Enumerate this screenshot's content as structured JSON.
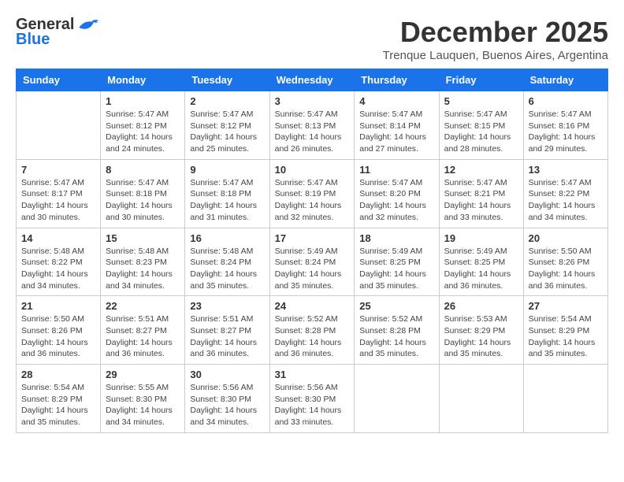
{
  "logo": {
    "general": "General",
    "blue": "Blue"
  },
  "title": "December 2025",
  "subtitle": "Trenque Lauquen, Buenos Aires, Argentina",
  "days_of_week": [
    "Sunday",
    "Monday",
    "Tuesday",
    "Wednesday",
    "Thursday",
    "Friday",
    "Saturday"
  ],
  "weeks": [
    [
      {
        "day": "",
        "info": ""
      },
      {
        "day": "1",
        "info": "Sunrise: 5:47 AM\nSunset: 8:12 PM\nDaylight: 14 hours\nand 24 minutes."
      },
      {
        "day": "2",
        "info": "Sunrise: 5:47 AM\nSunset: 8:12 PM\nDaylight: 14 hours\nand 25 minutes."
      },
      {
        "day": "3",
        "info": "Sunrise: 5:47 AM\nSunset: 8:13 PM\nDaylight: 14 hours\nand 26 minutes."
      },
      {
        "day": "4",
        "info": "Sunrise: 5:47 AM\nSunset: 8:14 PM\nDaylight: 14 hours\nand 27 minutes."
      },
      {
        "day": "5",
        "info": "Sunrise: 5:47 AM\nSunset: 8:15 PM\nDaylight: 14 hours\nand 28 minutes."
      },
      {
        "day": "6",
        "info": "Sunrise: 5:47 AM\nSunset: 8:16 PM\nDaylight: 14 hours\nand 29 minutes."
      }
    ],
    [
      {
        "day": "7",
        "info": "Sunrise: 5:47 AM\nSunset: 8:17 PM\nDaylight: 14 hours\nand 30 minutes."
      },
      {
        "day": "8",
        "info": "Sunrise: 5:47 AM\nSunset: 8:18 PM\nDaylight: 14 hours\nand 30 minutes."
      },
      {
        "day": "9",
        "info": "Sunrise: 5:47 AM\nSunset: 8:18 PM\nDaylight: 14 hours\nand 31 minutes."
      },
      {
        "day": "10",
        "info": "Sunrise: 5:47 AM\nSunset: 8:19 PM\nDaylight: 14 hours\nand 32 minutes."
      },
      {
        "day": "11",
        "info": "Sunrise: 5:47 AM\nSunset: 8:20 PM\nDaylight: 14 hours\nand 32 minutes."
      },
      {
        "day": "12",
        "info": "Sunrise: 5:47 AM\nSunset: 8:21 PM\nDaylight: 14 hours\nand 33 minutes."
      },
      {
        "day": "13",
        "info": "Sunrise: 5:47 AM\nSunset: 8:22 PM\nDaylight: 14 hours\nand 34 minutes."
      }
    ],
    [
      {
        "day": "14",
        "info": "Sunrise: 5:48 AM\nSunset: 8:22 PM\nDaylight: 14 hours\nand 34 minutes."
      },
      {
        "day": "15",
        "info": "Sunrise: 5:48 AM\nSunset: 8:23 PM\nDaylight: 14 hours\nand 34 minutes."
      },
      {
        "day": "16",
        "info": "Sunrise: 5:48 AM\nSunset: 8:24 PM\nDaylight: 14 hours\nand 35 minutes."
      },
      {
        "day": "17",
        "info": "Sunrise: 5:49 AM\nSunset: 8:24 PM\nDaylight: 14 hours\nand 35 minutes."
      },
      {
        "day": "18",
        "info": "Sunrise: 5:49 AM\nSunset: 8:25 PM\nDaylight: 14 hours\nand 35 minutes."
      },
      {
        "day": "19",
        "info": "Sunrise: 5:49 AM\nSunset: 8:25 PM\nDaylight: 14 hours\nand 36 minutes."
      },
      {
        "day": "20",
        "info": "Sunrise: 5:50 AM\nSunset: 8:26 PM\nDaylight: 14 hours\nand 36 minutes."
      }
    ],
    [
      {
        "day": "21",
        "info": "Sunrise: 5:50 AM\nSunset: 8:26 PM\nDaylight: 14 hours\nand 36 minutes."
      },
      {
        "day": "22",
        "info": "Sunrise: 5:51 AM\nSunset: 8:27 PM\nDaylight: 14 hours\nand 36 minutes."
      },
      {
        "day": "23",
        "info": "Sunrise: 5:51 AM\nSunset: 8:27 PM\nDaylight: 14 hours\nand 36 minutes."
      },
      {
        "day": "24",
        "info": "Sunrise: 5:52 AM\nSunset: 8:28 PM\nDaylight: 14 hours\nand 36 minutes."
      },
      {
        "day": "25",
        "info": "Sunrise: 5:52 AM\nSunset: 8:28 PM\nDaylight: 14 hours\nand 35 minutes."
      },
      {
        "day": "26",
        "info": "Sunrise: 5:53 AM\nSunset: 8:29 PM\nDaylight: 14 hours\nand 35 minutes."
      },
      {
        "day": "27",
        "info": "Sunrise: 5:54 AM\nSunset: 8:29 PM\nDaylight: 14 hours\nand 35 minutes."
      }
    ],
    [
      {
        "day": "28",
        "info": "Sunrise: 5:54 AM\nSunset: 8:29 PM\nDaylight: 14 hours\nand 35 minutes."
      },
      {
        "day": "29",
        "info": "Sunrise: 5:55 AM\nSunset: 8:30 PM\nDaylight: 14 hours\nand 34 minutes."
      },
      {
        "day": "30",
        "info": "Sunrise: 5:56 AM\nSunset: 8:30 PM\nDaylight: 14 hours\nand 34 minutes."
      },
      {
        "day": "31",
        "info": "Sunrise: 5:56 AM\nSunset: 8:30 PM\nDaylight: 14 hours\nand 33 minutes."
      },
      {
        "day": "",
        "info": ""
      },
      {
        "day": "",
        "info": ""
      },
      {
        "day": "",
        "info": ""
      }
    ]
  ]
}
